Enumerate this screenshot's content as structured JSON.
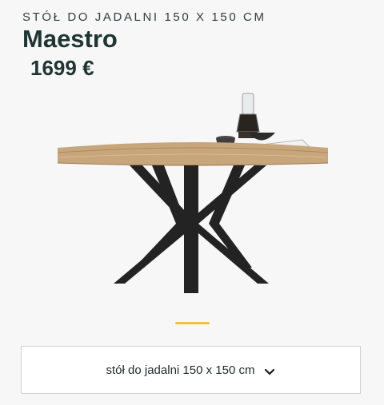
{
  "product": {
    "category": "STÓŁ DO JADALNI 150 X 150 CM",
    "name": "Maestro",
    "price": "1699 €"
  },
  "gallery": {
    "image_icon": "dining-table-product-photo",
    "indicator_color": "#f1c232"
  },
  "variant": {
    "selected": "stół do jadalni 150 x 150 cm",
    "icon": "chevron-down-icon"
  }
}
